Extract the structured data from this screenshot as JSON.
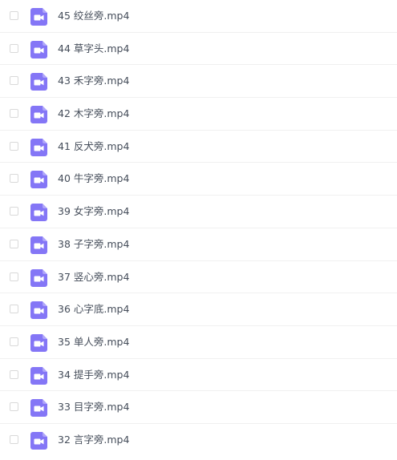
{
  "file_list": {
    "icon": "video-file-icon",
    "icon_color": "#8476f6",
    "items": [
      {
        "name": "45 绞丝旁.mp4"
      },
      {
        "name": "44 草字头.mp4"
      },
      {
        "name": "43 禾字旁.mp4"
      },
      {
        "name": "42 木字旁.mp4"
      },
      {
        "name": "41 反犬旁.mp4"
      },
      {
        "name": "40 牛字旁.mp4"
      },
      {
        "name": "39 女字旁.mp4"
      },
      {
        "name": "38 子字旁.mp4"
      },
      {
        "name": "37 竖心旁.mp4"
      },
      {
        "name": "36 心字底.mp4"
      },
      {
        "name": "35 单人旁.mp4"
      },
      {
        "name": "34 提手旁.mp4"
      },
      {
        "name": "33 目字旁.mp4"
      },
      {
        "name": "32 言字旁.mp4"
      }
    ]
  }
}
